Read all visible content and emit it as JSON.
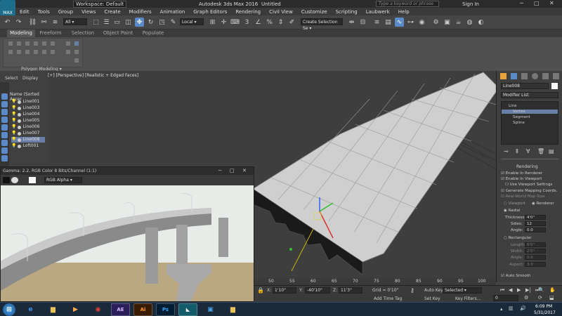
{
  "app": {
    "logo": "MAX",
    "title": "Autodesk 3ds Max 2016",
    "file": "Untitled",
    "workspace": "Workspace: Default",
    "search_placeholder": "Type a keyword or phrase",
    "sign_in": "Sign In"
  },
  "menu": [
    "Edit",
    "Tools",
    "Group",
    "Views",
    "Create",
    "Modifiers",
    "Animation",
    "Graph Editors",
    "Rendering",
    "Civil View",
    "Customize",
    "Scripting",
    "Laubwerk",
    "Help"
  ],
  "toolbar": {
    "selection_filter": "All",
    "ref_coord": "Local",
    "selection_set": "Create Selection Se"
  },
  "ribbon": {
    "tabs": [
      "Modeling",
      "Freeform",
      "Selection",
      "Object Paint",
      "Populate"
    ],
    "active_tab": "Modeling",
    "panel_label": "Polygon Modeling"
  },
  "explorer": {
    "tabs": [
      "Select",
      "Display"
    ],
    "header": "Name (Sorted Ascer",
    "items": [
      "Line001",
      "Line003",
      "Line004",
      "Line005",
      "Line006",
      "Line007",
      "Line008",
      "Loft001"
    ],
    "selected": "Line008"
  },
  "viewport": {
    "label": "[+] [Perspective] [Realistic + Edged Faces]"
  },
  "render_window": {
    "title": "Gamma: 2.2, RGB Color 8 Bits/Channel (1:1)",
    "channel": "RGB Alpha"
  },
  "command_panel": {
    "object_name": "Line008",
    "modifier_list": "Modifier List",
    "stack": [
      "Line",
      "Vertex",
      "Segment",
      "Spline"
    ],
    "stack_selected": "Vertex",
    "rollout": "Rendering",
    "options": [
      "Enable In Renderer",
      "Enable In Viewport",
      "Use Viewport Settings",
      "Generate Mapping Coords.",
      "Real-World Map Size"
    ],
    "viewport_label": "Viewport",
    "renderer_label": "Renderer",
    "radial_label": "Radial",
    "thickness_label": "Thickness:",
    "thickness_value": "4'0\"",
    "sides_label": "Sides:",
    "sides_value": "12",
    "angle_label": "Angle:",
    "angle_value": "0.0",
    "rect_label": "Rectangular",
    "length_label": "Length:",
    "length_value": "6'0\"",
    "width_label": "Width:",
    "width_value": "2'0\"",
    "rect_angle_label": "Angle:",
    "rect_angle_value": "0.0",
    "aspect_label": "Aspect:",
    "aspect_value": "3.0",
    "auto_smooth": "Auto Smooth"
  },
  "timeline": {
    "ticks": [
      "50",
      "55",
      "60",
      "65",
      "70",
      "75",
      "80",
      "85",
      "90",
      "95",
      "100"
    ]
  },
  "status": {
    "x_label": "X:",
    "x_value": "1'10\"",
    "y_label": "Y:",
    "y_value": "-40'10\"",
    "z_label": "Z:",
    "z_value": "11'3\"",
    "grid": "Grid = 0'10\"",
    "auto_key": "Auto Key",
    "selected": "Selected",
    "set_key": "Set Key",
    "key_filters": "Key Filters...",
    "add_time_tag": "Add Time Tag",
    "frame": "0"
  },
  "taskbar": {
    "apps": [
      "start",
      "ie",
      "folder",
      "media",
      "chrome",
      "word",
      "ae",
      "ai",
      "ps",
      "max",
      "explorer",
      "folder2"
    ],
    "time": "6:09 PM",
    "date": "5/31/2017"
  },
  "colors": {
    "accent": "#6a7fa6",
    "selection": "#1c6e8c"
  }
}
